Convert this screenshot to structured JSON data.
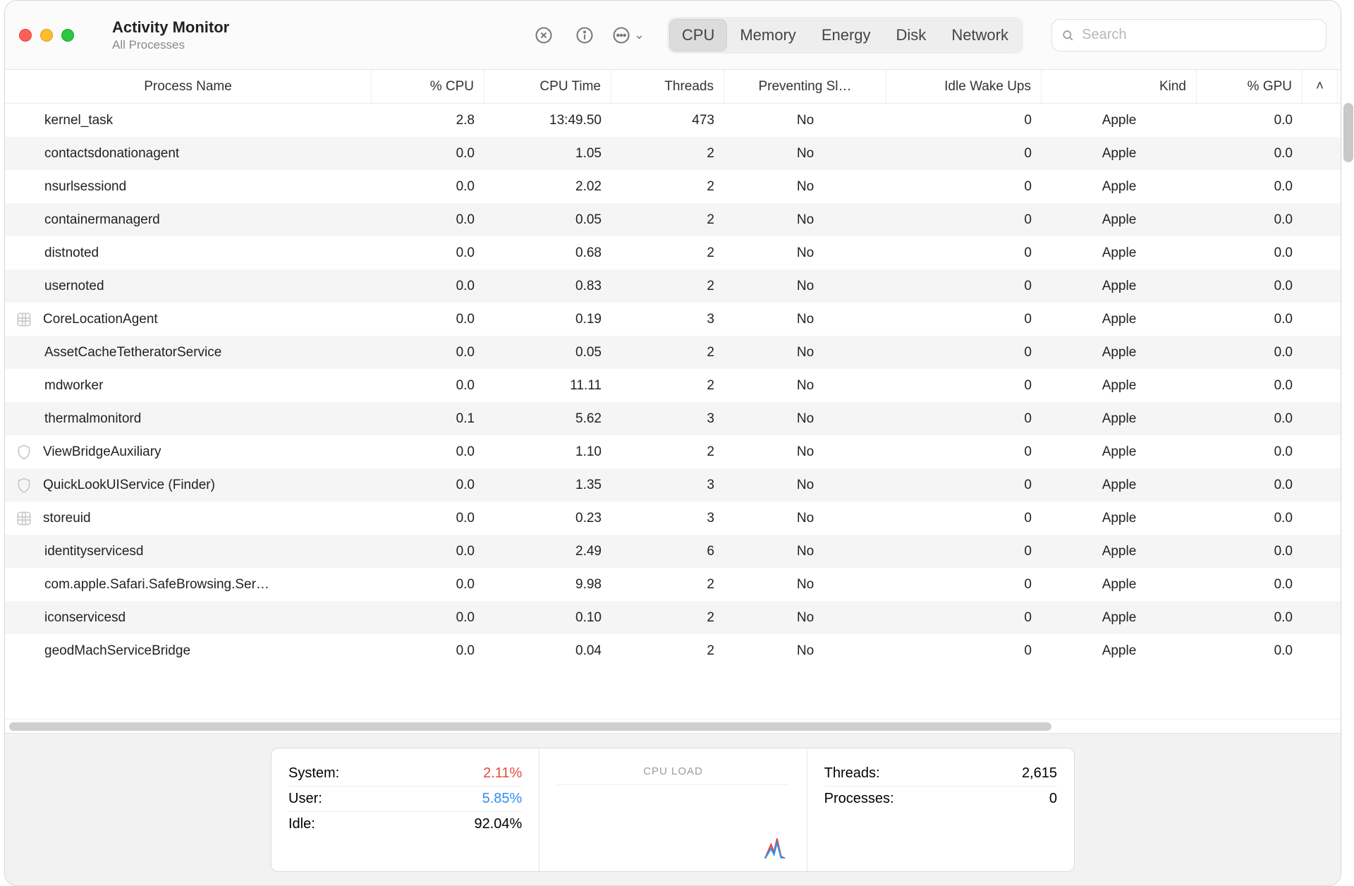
{
  "window": {
    "title": "Activity Monitor",
    "subtitle": "All Processes"
  },
  "search": {
    "placeholder": "Search"
  },
  "tabs": [
    "CPU",
    "Memory",
    "Energy",
    "Disk",
    "Network"
  ],
  "activeTab": 0,
  "columns": {
    "name": "Process Name",
    "cpu": "% CPU",
    "cputime": "CPU Time",
    "threads": "Threads",
    "sleep": "Preventing Sl…",
    "wake": "Idle Wake Ups",
    "kind": "Kind",
    "gpu": "% GPU"
  },
  "rows": [
    {
      "icon": "",
      "name": "kernel_task",
      "cpu": "2.8",
      "cputime": "13:49.50",
      "threads": "473",
      "sleep": "No",
      "wake": "0",
      "kind": "Apple",
      "gpu": "0.0"
    },
    {
      "icon": "",
      "name": "contactsdonationagent",
      "cpu": "0.0",
      "cputime": "1.05",
      "threads": "2",
      "sleep": "No",
      "wake": "0",
      "kind": "Apple",
      "gpu": "0.0"
    },
    {
      "icon": "",
      "name": "nsurlsessiond",
      "cpu": "0.0",
      "cputime": "2.02",
      "threads": "2",
      "sleep": "No",
      "wake": "0",
      "kind": "Apple",
      "gpu": "0.0"
    },
    {
      "icon": "",
      "name": "containermanagerd",
      "cpu": "0.0",
      "cputime": "0.05",
      "threads": "2",
      "sleep": "No",
      "wake": "0",
      "kind": "Apple",
      "gpu": "0.0"
    },
    {
      "icon": "",
      "name": "distnoted",
      "cpu": "0.0",
      "cputime": "0.68",
      "threads": "2",
      "sleep": "No",
      "wake": "0",
      "kind": "Apple",
      "gpu": "0.0"
    },
    {
      "icon": "",
      "name": "usernoted",
      "cpu": "0.0",
      "cputime": "0.83",
      "threads": "2",
      "sleep": "No",
      "wake": "0",
      "kind": "Apple",
      "gpu": "0.0"
    },
    {
      "icon": "grid",
      "name": "CoreLocationAgent",
      "cpu": "0.0",
      "cputime": "0.19",
      "threads": "3",
      "sleep": "No",
      "wake": "0",
      "kind": "Apple",
      "gpu": "0.0"
    },
    {
      "icon": "",
      "name": "AssetCacheTetheratorService",
      "cpu": "0.0",
      "cputime": "0.05",
      "threads": "2",
      "sleep": "No",
      "wake": "0",
      "kind": "Apple",
      "gpu": "0.0"
    },
    {
      "icon": "",
      "name": "mdworker",
      "cpu": "0.0",
      "cputime": "11.11",
      "threads": "2",
      "sleep": "No",
      "wake": "0",
      "kind": "Apple",
      "gpu": "0.0"
    },
    {
      "icon": "",
      "name": "thermalmonitord",
      "cpu": "0.1",
      "cputime": "5.62",
      "threads": "3",
      "sleep": "No",
      "wake": "0",
      "kind": "Apple",
      "gpu": "0.0"
    },
    {
      "icon": "shield",
      "name": "ViewBridgeAuxiliary",
      "cpu": "0.0",
      "cputime": "1.10",
      "threads": "2",
      "sleep": "No",
      "wake": "0",
      "kind": "Apple",
      "gpu": "0.0"
    },
    {
      "icon": "shield",
      "name": "QuickLookUIService (Finder)",
      "cpu": "0.0",
      "cputime": "1.35",
      "threads": "3",
      "sleep": "No",
      "wake": "0",
      "kind": "Apple",
      "gpu": "0.0"
    },
    {
      "icon": "grid",
      "name": "storeuid",
      "cpu": "0.0",
      "cputime": "0.23",
      "threads": "3",
      "sleep": "No",
      "wake": "0",
      "kind": "Apple",
      "gpu": "0.0"
    },
    {
      "icon": "",
      "name": "identityservicesd",
      "cpu": "0.0",
      "cputime": "2.49",
      "threads": "6",
      "sleep": "No",
      "wake": "0",
      "kind": "Apple",
      "gpu": "0.0"
    },
    {
      "icon": "",
      "name": "com.apple.Safari.SafeBrowsing.Ser…",
      "cpu": "0.0",
      "cputime": "9.98",
      "threads": "2",
      "sleep": "No",
      "wake": "0",
      "kind": "Apple",
      "gpu": "0.0"
    },
    {
      "icon": "",
      "name": "iconservicesd",
      "cpu": "0.0",
      "cputime": "0.10",
      "threads": "2",
      "sleep": "No",
      "wake": "0",
      "kind": "Apple",
      "gpu": "0.0"
    },
    {
      "icon": "",
      "name": "geodMachServiceBridge",
      "cpu": "0.0",
      "cputime": "0.04",
      "threads": "2",
      "sleep": "No",
      "wake": "0",
      "kind": "Apple",
      "gpu": "0.0"
    }
  ],
  "stats": {
    "system_label": "System:",
    "system_val": "2.11%",
    "user_label": "User:",
    "user_val": "5.85%",
    "idle_label": "Idle:",
    "idle_val": "92.04%",
    "load_title": "CPU LOAD",
    "threads_label": "Threads:",
    "threads_val": "2,615",
    "procs_label": "Processes:",
    "procs_val": "0"
  }
}
